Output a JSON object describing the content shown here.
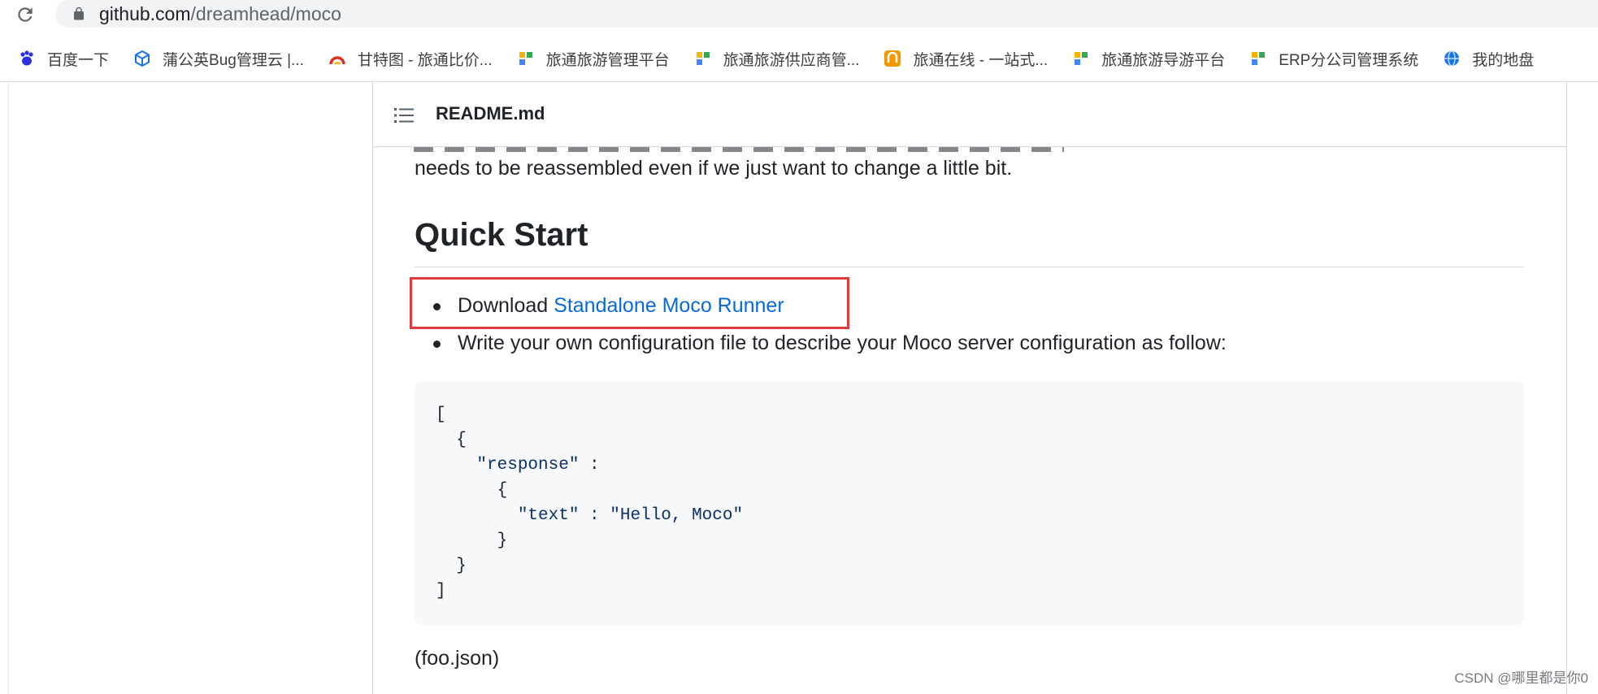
{
  "browser": {
    "url_host": "github.com",
    "url_path": "/dreamhead/moco"
  },
  "bookmarks": [
    {
      "label": "百度一下",
      "icon": "baidu-paw-icon",
      "color": "#2932e1"
    },
    {
      "label": "蒲公英Bug管理云 |...",
      "icon": "cube-icon",
      "color": "#1a73e8"
    },
    {
      "label": "甘特图 - 旅通比价...",
      "icon": "gantt-arc-icon",
      "color": "#d93025"
    },
    {
      "label": "旅通旅游管理平台",
      "icon": "tiles-icon",
      "color": "#f4b400"
    },
    {
      "label": "旅通旅游供应商管...",
      "icon": "tiles-icon",
      "color": "#f4b400"
    },
    {
      "label": "旅通在线 - 一站式...",
      "icon": "orange-app-icon",
      "color": "#f29900"
    },
    {
      "label": "旅通旅游导游平台",
      "icon": "tiles-icon",
      "color": "#f4b400"
    },
    {
      "label": "ERP分公司管理系统",
      "icon": "tiles-icon",
      "color": "#f4b400"
    },
    {
      "label": "我的地盘",
      "icon": "globe-icon",
      "color": "#1a73e8"
    }
  ],
  "readme": {
    "filename": "README.md",
    "intro_tail": "needs to be reassembled even if we just want to change a little bit.",
    "heading": "Quick Start",
    "bullet1_prefix": "Download ",
    "bullet1_link": "Standalone Moco Runner",
    "bullet2": "Write your own configuration file to describe your Moco server configuration as follow:",
    "code": {
      "l1": "[",
      "l2": "  {",
      "l3_key": "\"response\"",
      "l3_rest": " :",
      "l4": "      {",
      "l5_key": "\"text\"",
      "l5_rest": " : \"Hello, Moco\"",
      "l6": "      }",
      "l7": "  }",
      "l8": "]"
    },
    "filename_note": "(foo.json)"
  },
  "watermark": "CSDN @哪里都是你0",
  "colors": {
    "link": "#0969da",
    "highlight_box": "#e03c3c"
  }
}
